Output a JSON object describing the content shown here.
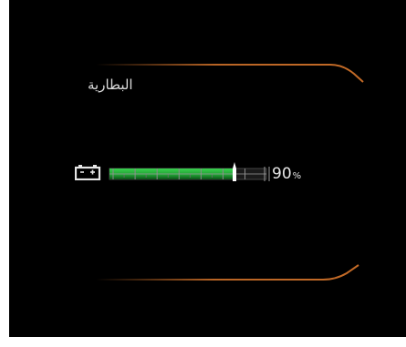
{
  "battery": {
    "title": "البطارية",
    "level_value": "90",
    "level_unit": "%",
    "level_fraction": 0.9
  },
  "colors": {
    "background": "#000000",
    "accent": "#d9762b",
    "gauge_fill": "#21b138",
    "text": "#e6e6e6"
  }
}
